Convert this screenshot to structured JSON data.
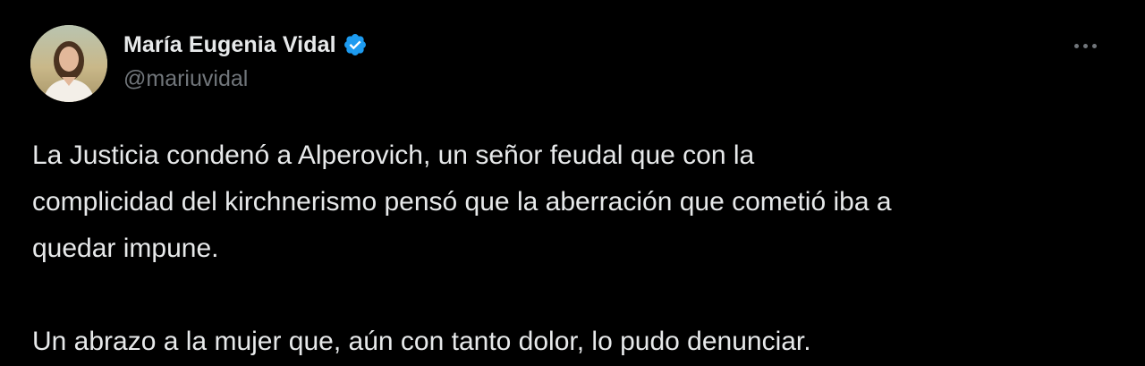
{
  "author": {
    "display_name": "María Eugenia Vidal",
    "handle": "@mariuvidal",
    "verified": true,
    "avatar_icon": "profile-photo"
  },
  "tweet": {
    "text_line_1": "La Justicia condenó a Alperovich, un señor feudal que con la",
    "text_line_2": "complicidad del kirchnerismo pensó que la aberración que cometió iba a",
    "text_line_3": "quedar impune.",
    "paragraph_2": "Un abrazo a la mujer que, aún con tanto dolor, lo pudo denunciar."
  },
  "icons": {
    "verified": "verified-badge-icon",
    "more": "more-options-icon"
  },
  "colors": {
    "background": "#000000",
    "text_primary": "#e7e9ea",
    "text_secondary": "#71767b",
    "verified_blue": "#1d9bf0"
  }
}
